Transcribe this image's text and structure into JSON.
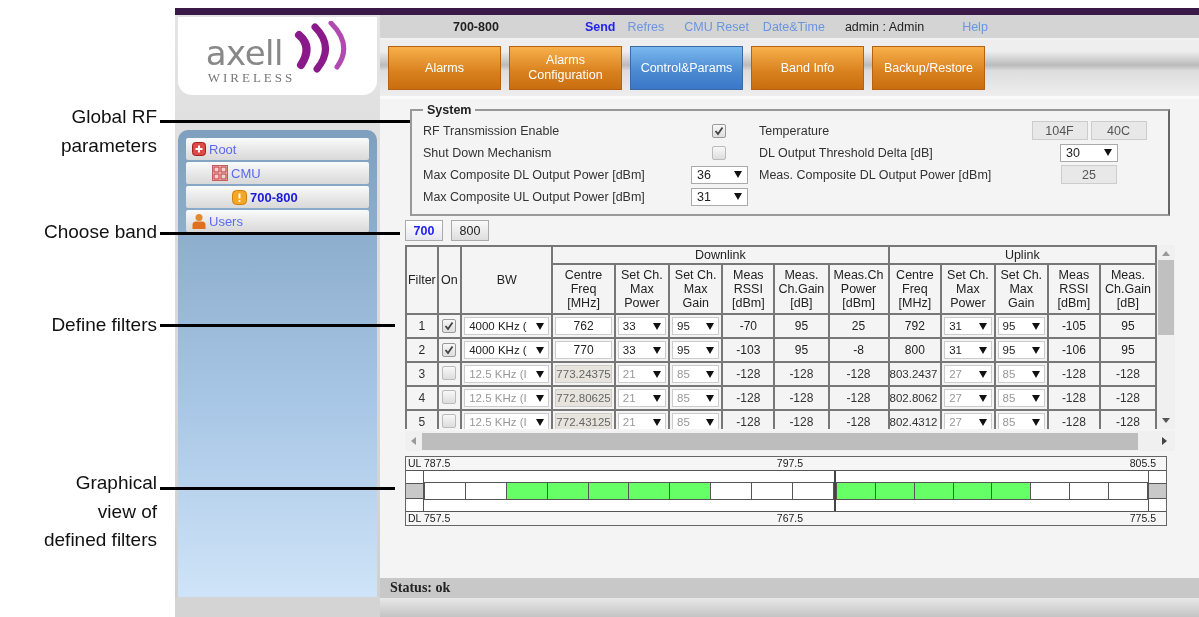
{
  "annotations": [
    {
      "text": "Global RF parameters"
    },
    {
      "text": "Choose band"
    },
    {
      "text": "Define filters"
    },
    {
      "text": "Graphical view of defined filters"
    }
  ],
  "logo": {
    "name": "axell",
    "tagline": "WIRELESS"
  },
  "tree": [
    {
      "label": "Root",
      "kind": "root",
      "selected": false,
      "children": [
        {
          "label": "CMU",
          "kind": "device",
          "selected": false,
          "children": [
            {
              "label": "700-800",
              "kind": "band",
              "selected": true
            }
          ]
        }
      ]
    },
    {
      "label": "Users",
      "kind": "users",
      "selected": false
    }
  ],
  "header": [
    {
      "kind": "band",
      "text": "700-800"
    },
    {
      "kind": "link",
      "text": "Send",
      "emphasized": true
    },
    {
      "kind": "link",
      "text": "Refres",
      "emphasized": false
    },
    {
      "kind": "link",
      "text": "CMU Reset",
      "emphasized": false
    },
    {
      "kind": "link",
      "text": "Date&Time",
      "emphasized": false
    },
    {
      "kind": "user",
      "text": "admin : Admin"
    },
    {
      "kind": "link",
      "text": "Help",
      "emphasized": false
    }
  ],
  "tabs": [
    {
      "label": "Alarms",
      "selected": false
    },
    {
      "label": "Alarms Configuration",
      "selected": false
    },
    {
      "label": "Control&Params",
      "selected": true
    },
    {
      "label": "Band Info",
      "selected": false
    },
    {
      "label": "Backup/Restore",
      "selected": false
    }
  ],
  "system": {
    "title": "System",
    "left": [
      {
        "kind": "checkbox",
        "label": "RF Transmission Enable",
        "checked": true
      },
      {
        "kind": "checkbox",
        "label": "Shut Down Mechanism",
        "checked": false
      },
      {
        "kind": "select",
        "label": "Max Composite DL Output Power [dBm]",
        "value": "36"
      },
      {
        "kind": "select",
        "label": "Max Composite UL Output Power [dBm]",
        "value": "31"
      }
    ],
    "right": [
      {
        "kind": "readout",
        "label": "Temperature",
        "values": [
          "104F",
          "40C"
        ]
      },
      {
        "kind": "select",
        "label": "DL Output Threshold Delta [dB]",
        "value": "30"
      },
      {
        "kind": "readout",
        "label": "Meas. Composite DL Output Power [dBm]",
        "values": [
          "25"
        ]
      }
    ]
  },
  "bands": [
    {
      "label": "700",
      "selected": true
    },
    {
      "label": "800",
      "selected": false
    }
  ],
  "table": {
    "fixed_columns": [
      "Filter",
      "On",
      "BW"
    ],
    "groups": [
      {
        "label": "Downlink",
        "columns": [
          {
            "label": "Centre Freq [MHz]",
            "kind": "input"
          },
          {
            "label": "Set Ch. Max Power",
            "kind": "select"
          },
          {
            "label": "Set Ch. Max Gain",
            "kind": "select"
          },
          {
            "label": "Meas RSSI [dBm]",
            "kind": "text"
          },
          {
            "label": "Meas. Ch.Gain [dB]",
            "kind": "text"
          },
          {
            "label": "Meas.Ch Power [dBm]",
            "kind": "text"
          }
        ]
      },
      {
        "label": "Uplink",
        "columns": [
          {
            "label": "Centre Freq [MHz]",
            "kind": "text"
          },
          {
            "label": "Set Ch. Max Power",
            "kind": "select"
          },
          {
            "label": "Set Ch. Max Gain",
            "kind": "select"
          },
          {
            "label": "Meas RSSI [dBm]",
            "kind": "text"
          },
          {
            "label": "Meas. Ch.Gain [dB]",
            "kind": "text"
          }
        ]
      }
    ],
    "rows": [
      {
        "filter": "1",
        "on": true,
        "bw": "4000 KHz (",
        "cells": [
          [
            "762",
            "33",
            "95",
            "-70",
            "95",
            "25"
          ],
          [
            "792",
            "31",
            "95",
            "-105",
            "95"
          ]
        ]
      },
      {
        "filter": "2",
        "on": true,
        "bw": "4000 KHz (",
        "cells": [
          [
            "770",
            "33",
            "95",
            "-103",
            "95",
            "-8"
          ],
          [
            "800",
            "31",
            "95",
            "-106",
            "95"
          ]
        ]
      },
      {
        "filter": "3",
        "on": false,
        "bw": "12.5 KHz (I",
        "cells": [
          [
            "773.24375",
            "21",
            "85",
            "-128",
            "-128",
            "-128"
          ],
          [
            "803.2437",
            "27",
            "85",
            "-128",
            "-128"
          ]
        ]
      },
      {
        "filter": "4",
        "on": false,
        "bw": "12.5 KHz (I",
        "cells": [
          [
            "772.80625",
            "21",
            "85",
            "-128",
            "-128",
            "-128"
          ],
          [
            "802.8062",
            "27",
            "85",
            "-128",
            "-128"
          ]
        ]
      },
      {
        "filter": "5",
        "on": false,
        "bw": "12.5 KHz (I",
        "cells": [
          [
            "772.43125",
            "21",
            "85",
            "-128",
            "-128",
            "-128"
          ],
          [
            "802.4312",
            "27",
            "85",
            "-128",
            "-128"
          ]
        ]
      }
    ]
  },
  "graph": {
    "ul_scale": [
      "UL 787.5",
      "797.5",
      "805.5"
    ],
    "dl_scale": [
      "DL 757.5",
      "767.5",
      "775.5"
    ],
    "halves": [
      [
        {
          "active": false
        },
        {
          "active": false
        },
        {
          "active": true
        },
        {
          "active": true
        },
        {
          "active": true
        },
        {
          "active": true
        },
        {
          "active": true
        },
        {
          "active": false
        },
        {
          "active": false
        },
        {
          "active": false
        }
      ],
      [
        {
          "active": true
        },
        {
          "active": true
        },
        {
          "active": true
        },
        {
          "active": true
        },
        {
          "active": true
        },
        {
          "active": false
        },
        {
          "active": false
        },
        {
          "active": false
        }
      ]
    ]
  },
  "status": {
    "text": "Status: ok"
  }
}
